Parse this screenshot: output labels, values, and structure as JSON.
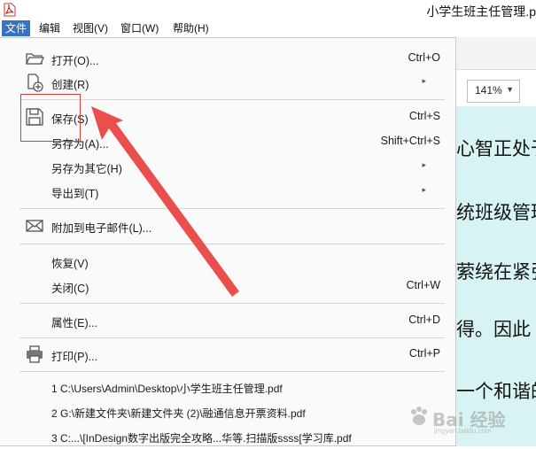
{
  "title_bar": {
    "document_title": "小学生班主任管理.p"
  },
  "menubar": {
    "items": [
      {
        "label": "文件"
      },
      {
        "label": "编辑"
      },
      {
        "label": "视图(V)"
      },
      {
        "label": "窗口(W)"
      },
      {
        "label": "帮助(H)"
      }
    ]
  },
  "toolbar": {
    "zoom": "141%"
  },
  "document": {
    "lines": [
      "心智正处于",
      "统班级管理",
      "萦绕在紧张",
      "得。因此",
      "一个和谐的"
    ]
  },
  "file_menu": {
    "items": [
      {
        "label": "打开(O)...",
        "shortcut": "Ctrl+O",
        "icon": "folder-open-icon"
      },
      {
        "label": "创建(R)",
        "submenu": true,
        "icon": "create-document-icon"
      },
      {
        "label": "保存(S)",
        "shortcut": "Ctrl+S",
        "icon": "save-icon"
      },
      {
        "label": "另存为(A)...",
        "shortcut": "Shift+Ctrl+S"
      },
      {
        "label": "另存为其它(H)",
        "submenu": true
      },
      {
        "label": "导出到(T)",
        "submenu": true
      },
      {
        "label": "附加到电子邮件(L)...",
        "icon": "email-icon"
      },
      {
        "label": "恢复(V)"
      },
      {
        "label": "关闭(C)",
        "shortcut": "Ctrl+W"
      },
      {
        "label": "属性(E)...",
        "shortcut": "Ctrl+D"
      },
      {
        "label": "打印(P)...",
        "shortcut": "Ctrl+P",
        "icon": "printer-icon"
      }
    ],
    "submenu_arrow": "▸",
    "recent_files": [
      "1 C:\\Users\\Admin\\Desktop\\小学生班主任管理.pdf",
      "2 G:\\新建文件夹\\新建文件夹 (2)\\融通信息开票资料.pdf",
      "3 C:...\\[InDesign数字出版完全攻略...华等.扫描版ssss[学习库.pdf"
    ]
  },
  "annotation": {
    "highlight_color": "#e03b3b"
  },
  "watermark": {
    "text": "Bai 经验",
    "sub": "jingyan.baidu.com"
  }
}
